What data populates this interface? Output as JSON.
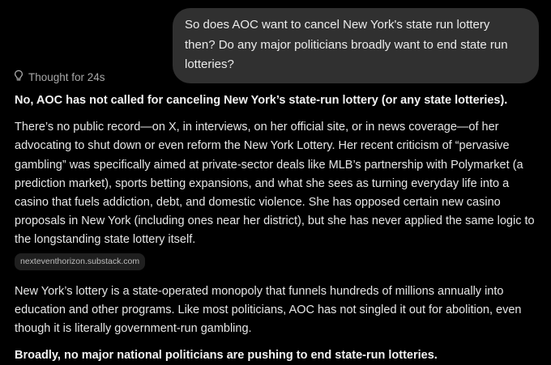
{
  "conversation": {
    "user_message": "So does AOC want to cancel New York's state run lottery then? Do any major politicians broadly want to end state run lotteries?",
    "thought_label": "Thought for 24s",
    "thought_icon": "lightbulb-icon",
    "response": {
      "heading": "No, AOC has not called for canceling New York’s state-run lottery (or any state lotteries).",
      "paragraph_1": "There’s no public record—on X, in interviews, on her official site, or in news coverage—of her advocating to shut down or even reform the New York Lottery. Her recent criticism of “pervasive gambling” was specifically aimed at private-sector deals like MLB’s partnership with Polymarket (a prediction market), sports betting expansions, and what she sees as turning everyday life into a casino that fuels addiction, debt, and domestic violence. She has opposed certain new casino proposals in New York (including ones near her district), but she has never applied the same logic to the longstanding state lottery itself.",
      "source_chip": "nexteventhorizon.substack.com",
      "paragraph_2": "New York’s lottery is a state-operated monopoly that funnels hundreds of millions annually into education and other programs. Like most politicians, AOC has not singled it out for abolition, even though it is literally government-run gambling.",
      "closing_heading": "Broadly, no major national politicians are pushing to end state-run lotteries."
    }
  },
  "colors": {
    "background": "#000000",
    "user_bubble": "#303030",
    "text": "#e6e6e6",
    "muted": "#a8a8a8",
    "chip_bg": "#1f1f1f"
  }
}
